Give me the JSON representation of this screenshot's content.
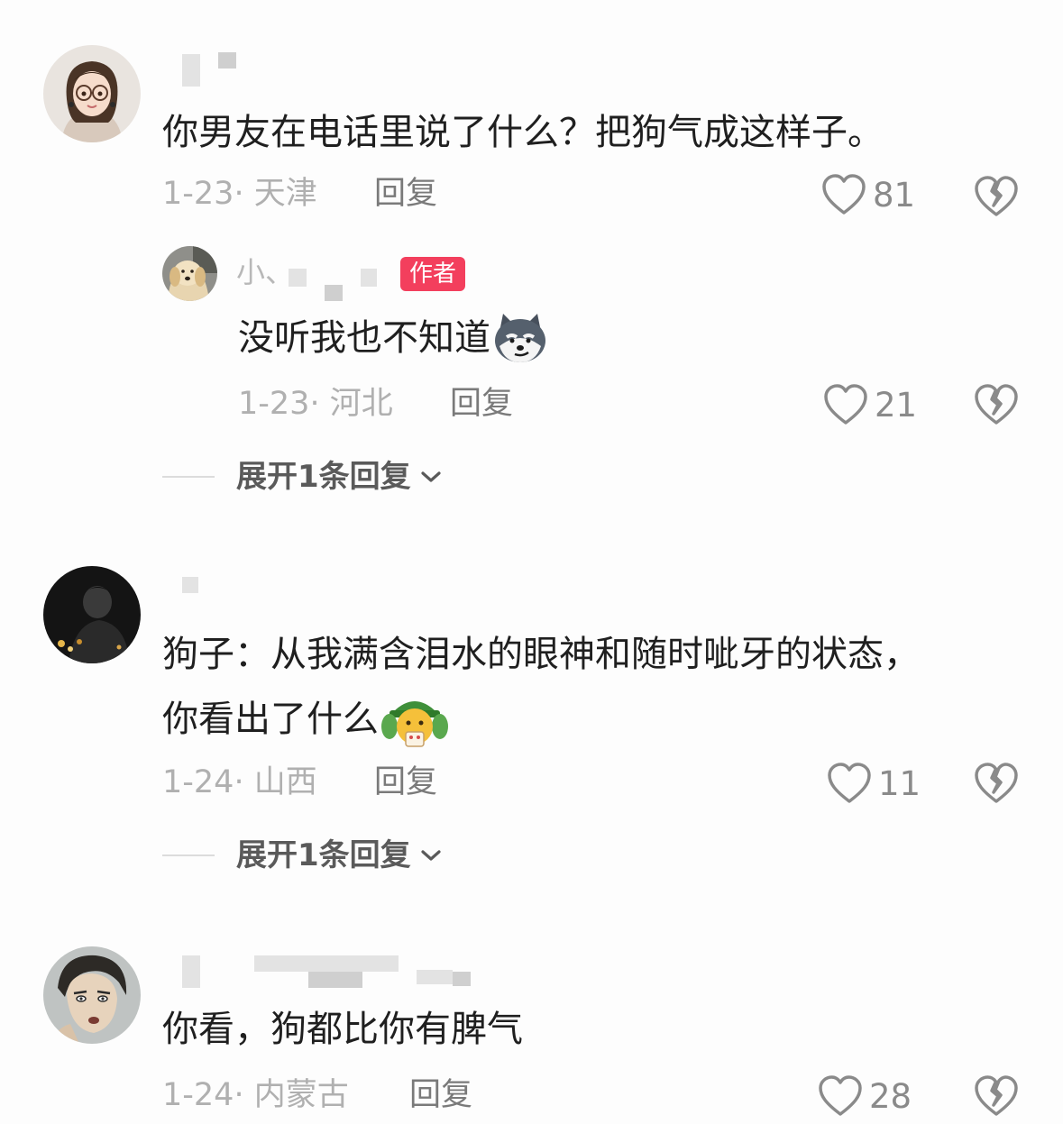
{
  "comments": [
    {
      "name": "",
      "text": "你男友在电话里说了什么？把狗气成这样子。",
      "date": "1-23",
      "location": "天津",
      "reply_label": "回复",
      "likes": "81",
      "avatar_icon": "girl-with-glasses-avatar",
      "reply": {
        "name_visible": "小、",
        "author_badge": "作者",
        "text": "没听我也不知道",
        "emoji_icon": "husky-smirk-emoji",
        "date": "1-23",
        "location": "河北",
        "reply_label": "回复",
        "likes": "21",
        "avatar_icon": "golden-retriever-avatar"
      },
      "expand_label": "展开1条回复"
    },
    {
      "name": "",
      "text_line1": "狗子：从我满含泪水的眼神和随时呲牙的状态，",
      "text_line2": "你看出了什么",
      "emoji_icon": "green-hat-emoji",
      "date": "1-24",
      "location": "山西",
      "reply_label": "回复",
      "likes": "11",
      "avatar_icon": "dark-photo-avatar",
      "expand_label": "展开1条回复"
    },
    {
      "name": "",
      "text": "你看，狗都比你有脾气",
      "date": "1-24",
      "location": "内蒙古",
      "reply_label": "回复",
      "likes": "28",
      "avatar_icon": "anime-man-avatar"
    }
  ],
  "colors": {
    "author_badge": "#f33f5d",
    "meta_text": "#b0b0b0",
    "body_text": "#1f1f1f"
  }
}
